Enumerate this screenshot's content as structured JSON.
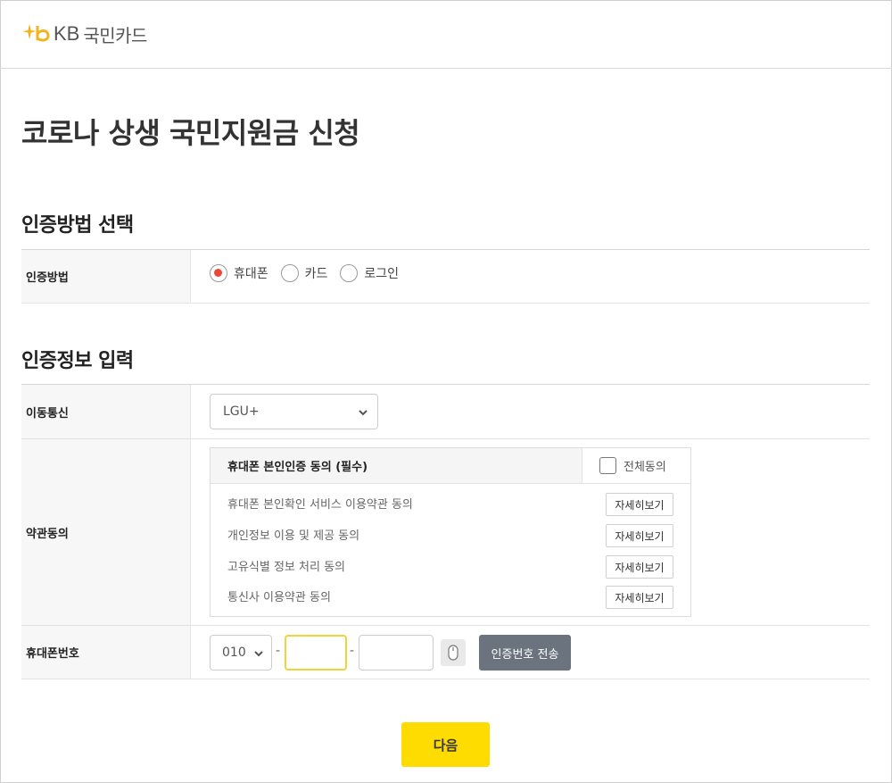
{
  "header": {
    "logo_text": "국민카드",
    "logo_kb": "KB"
  },
  "page": {
    "title": "코로나 상생 국민지원금 신청"
  },
  "auth_method_section": {
    "title": "인증방법 선택",
    "row_label": "인증방법",
    "options": [
      {
        "label": "휴대폰",
        "selected": true
      },
      {
        "label": "카드",
        "selected": false
      },
      {
        "label": "로그인",
        "selected": false
      }
    ]
  },
  "auth_info_section": {
    "title": "인증정보 입력",
    "carrier": {
      "label": "이동통신",
      "value": "LGU+"
    },
    "terms": {
      "label": "약관동의",
      "header_title": "휴대폰 본인인증 동의 (필수)",
      "agree_all_label": "전체동의",
      "items": [
        {
          "label": "휴대폰 본인확인 서비스 이용약관 동의",
          "button": "자세히보기"
        },
        {
          "label": "개인정보 이용 및 제공 동의",
          "button": "자세히보기"
        },
        {
          "label": "고유식별 정보 처리 동의",
          "button": "자세히보기"
        },
        {
          "label": "통신사 이용약관 동의",
          "button": "자세히보기"
        }
      ]
    },
    "phone": {
      "label": "휴대폰번호",
      "prefix": "010",
      "separator": "-",
      "middle_value": "",
      "last_value": "",
      "send_button": "인증번호 전송"
    }
  },
  "footer": {
    "next_button": "다음"
  },
  "colors": {
    "accent": "#ffdc00",
    "radio_selected": "#e84a3a",
    "send_button": "#6b747e",
    "logo": "#f5b21f"
  },
  "icons": {
    "logo": "kb-star-logo-icon",
    "dropdown": "chevron-down-icon",
    "keypad": "mouse-icon"
  }
}
